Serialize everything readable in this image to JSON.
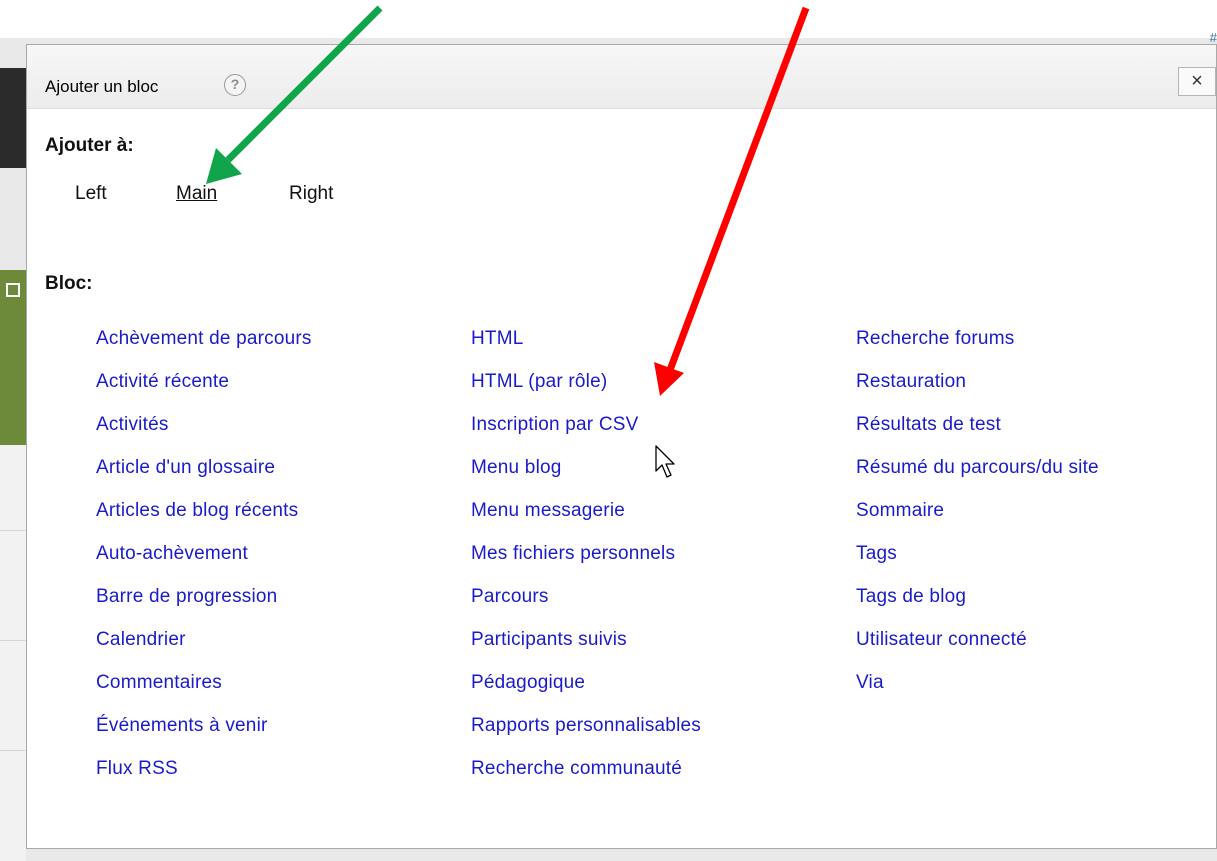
{
  "dialog": {
    "title": "Ajouter un bloc",
    "help_glyph": "?",
    "close_glyph": "×"
  },
  "add_to": {
    "label": "Ajouter à:",
    "regions": [
      "Left",
      "Main",
      "Right"
    ],
    "selected": "Main"
  },
  "blocks": {
    "label": "Bloc:",
    "col1": [
      "Achèvement de parcours",
      "Activité récente",
      "Activités",
      "Article d'un glossaire",
      "Articles de blog récents",
      "Auto-achèvement",
      "Barre de progression",
      "Calendrier",
      "Commentaires",
      "Événements à venir",
      "Flux RSS"
    ],
    "col2": [
      "HTML",
      "HTML (par rôle)",
      "Inscription par CSV",
      "Menu blog",
      "Menu messagerie",
      "Mes fichiers personnels",
      "Parcours",
      "Participants suivis",
      "Pédagogique",
      "Rapports personnalisables",
      "Recherche communauté"
    ],
    "col3": [
      "Recherche forums",
      "Restauration",
      "Résultats de test",
      "Résumé du parcours/du site",
      "Sommaire",
      "Tags",
      "Tags de blog",
      "Utilisateur connecté",
      "Via"
    ]
  },
  "background": {
    "corner_glyph": "#"
  },
  "annotations": {
    "green_arrow_color": "#10a54a",
    "red_arrow_color": "#ff0000",
    "link_color": "#1a1acc"
  }
}
